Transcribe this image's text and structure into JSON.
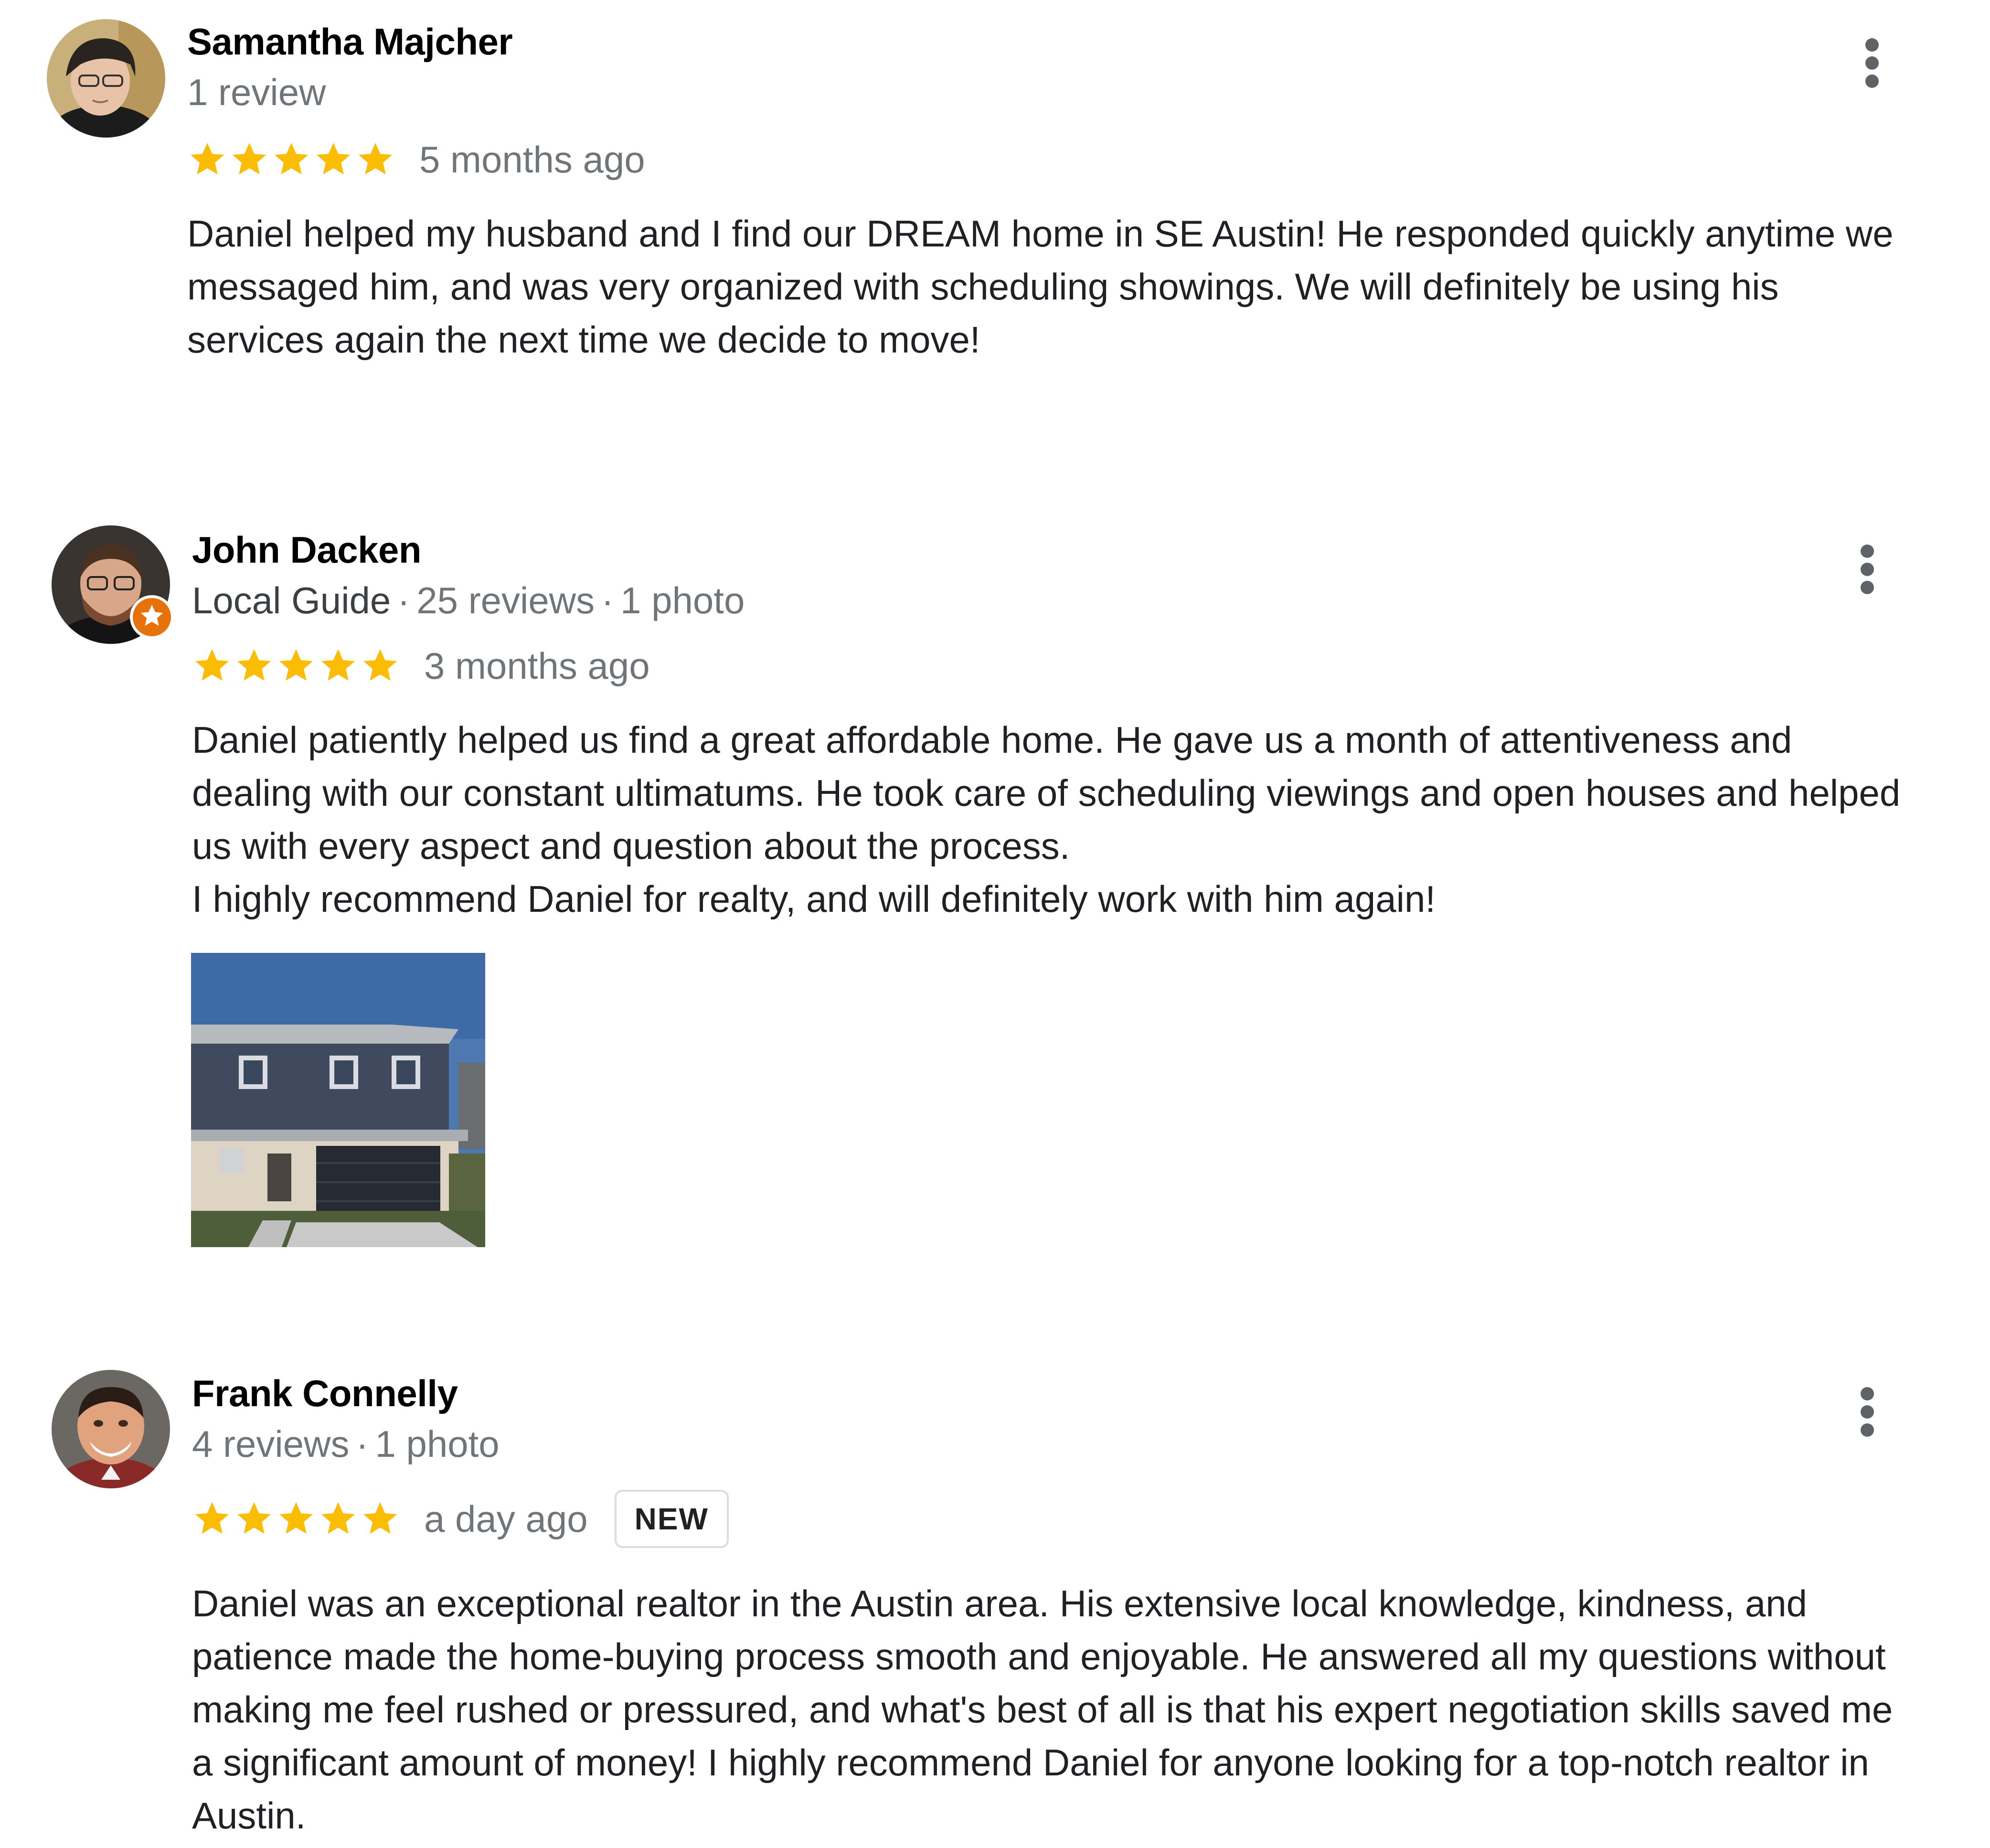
{
  "reviews": [
    {
      "name": "Samantha Majcher",
      "meta": "1 review",
      "rating": 5,
      "age": "5 months ago",
      "text": "Daniel helped my husband and I find our DREAM home in SE Austin!  He responded quickly anytime we\nmessaged him, and was very organized with scheduling showings.  We will definitely be using his\nservices again the next time we decide to move!"
    },
    {
      "name": "John Dacken",
      "guide": "Local Guide",
      "reviews_count": "25 reviews",
      "photos_count": "1 photo",
      "rating": 5,
      "age": "3 months ago",
      "text": "Daniel patiently helped us find a great affordable home. He gave us a month of attentiveness and\ndealing with our constant ultimatums. He took care of scheduling viewings and open houses and helped\nus with every aspect and question about the process.\nI highly recommend Daniel for realty, and will definitely work with him again!"
    },
    {
      "name": "Frank Connelly",
      "reviews_count": "4 reviews",
      "photos_count": "1 photo",
      "rating": 5,
      "age": "a day ago",
      "badge": "NEW",
      "text": "Daniel was an exceptional realtor in the Austin area. His extensive local knowledge, kindness, and\npatience made the home-buying process smooth and enjoyable. He answered all my questions without\nmaking me feel rushed or pressured, and what's best of all is that his expert negotiation skills saved me\na significant amount of money! I highly recommend Daniel for anyone looking for a top-notch realtor in\nAustin."
    }
  ],
  "separator": "·",
  "colors": {
    "star": "#fbbc04",
    "name": "#000000",
    "meta": "#70757a",
    "body": "#202124",
    "guide_badge": "#e8710a",
    "kebab": "#5f6368"
  },
  "icons": {
    "star": "star-icon",
    "more": "more-vert-icon",
    "local_guide": "local-guide-badge-icon"
  }
}
